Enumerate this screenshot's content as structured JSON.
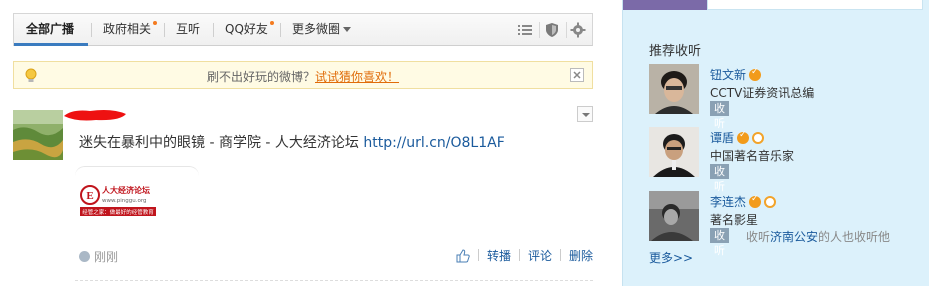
{
  "tabs": [
    {
      "label": "全部广播",
      "active": true,
      "dot": false
    },
    {
      "label": "政府相关",
      "active": false,
      "dot": true
    },
    {
      "label": "互听",
      "active": false,
      "dot": false
    },
    {
      "label": "QQ好友",
      "active": false,
      "dot": true
    },
    {
      "label": "更多微圈",
      "active": false,
      "dot": false
    }
  ],
  "toolbar_icons": [
    "list-view-icon",
    "shield-icon",
    "gear-icon"
  ],
  "notice": {
    "text": "刷不出好玩的微博？",
    "link": "试试猜你喜欢！"
  },
  "post": {
    "text": "迷失在暴利中的眼镜 - 商学院 - 人大经济论坛 ",
    "url": "http://url.cn/O8L1AF",
    "logo_title": "人大经济论坛",
    "logo_url": "www.pinggu.org",
    "logo_slogan": "经管之家：做最好的经管教育",
    "time": "刚刚",
    "actions": {
      "repost": "转播",
      "comment": "评论",
      "delete": "删除"
    }
  },
  "sidebar": {
    "title": "推荐收听",
    "follow_label": "收听",
    "more": "更多>>",
    "people": [
      {
        "name": "钮文新",
        "desc": "CCTV证券资讯总编",
        "verified": true,
        "medal": false
      },
      {
        "name": "谭盾",
        "desc": "中国著名音乐家",
        "verified": true,
        "medal": true
      },
      {
        "name": "李连杰",
        "desc": "著名影星",
        "verified": true,
        "medal": true,
        "social_pre": "收听",
        "social_hl": "济南公安",
        "social_post": "的人也收听他"
      }
    ]
  },
  "colors": {
    "accent": "#3a7bbf",
    "link": "#1a5a9c",
    "orange": "#e06c0a",
    "sidebar_bg": "#dcf1fb"
  }
}
